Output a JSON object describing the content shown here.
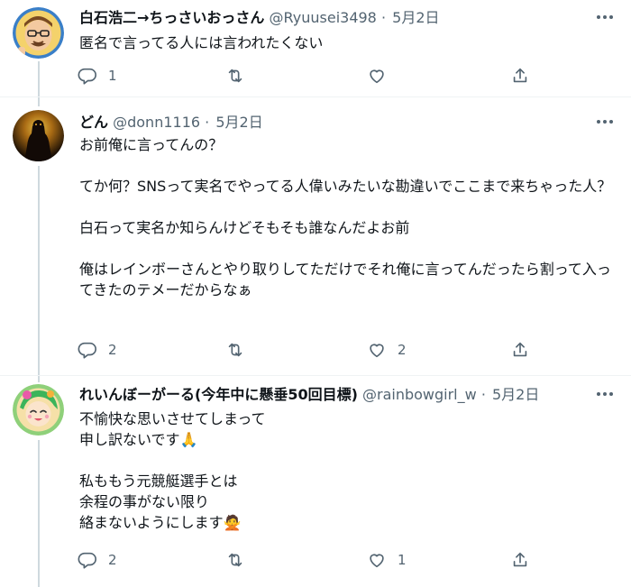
{
  "tweets": [
    {
      "name": "白石浩二→ちっさいおっさん",
      "handle": "@Ryuusei3498",
      "sep": "·",
      "date": "5月2日",
      "body": [
        "匿名で言ってる人には言われたくない"
      ],
      "reply_count": "1",
      "retweet_count": "",
      "like_count": "",
      "avatar_icon": "cartoon-face-avatar"
    },
    {
      "name": "どん",
      "handle": "@donn1116",
      "sep": "·",
      "date": "5月2日",
      "body": [
        "お前俺に言ってんの？",
        "",
        "てか何？SNSって実名でやってる人偉いみたいな勘違いでここまで来ちゃった人？",
        "",
        "白石って実名か知らんけどそもそも誰なんだよお前",
        "",
        "俺はレインボーさんとやり取りしてただけでそれ俺に言ってんだったら割って入ってきたのテメーだからなぁ"
      ],
      "reply_count": "2",
      "retweet_count": "",
      "like_count": "2",
      "avatar_icon": "dark-figure-avatar"
    },
    {
      "name": "れいんぼーがーる(今年中に懸垂50回目標)",
      "handle": "@rainbowgirl_w",
      "sep": "·",
      "date": "5月2日",
      "body": [
        "不愉快な思いさせてしまって",
        "申し訳ないです🙏",
        "",
        "私ももう元競艇選手とは",
        "余程の事がない限り",
        "絡まないようにします🙅"
      ],
      "reply_count": "2",
      "retweet_count": "",
      "like_count": "1",
      "avatar_icon": "anime-girl-avatar"
    }
  ],
  "colors": {
    "text": "#0f1419",
    "muted": "#536471",
    "divider": "#eff3f4",
    "thread": "#cfd9de"
  }
}
